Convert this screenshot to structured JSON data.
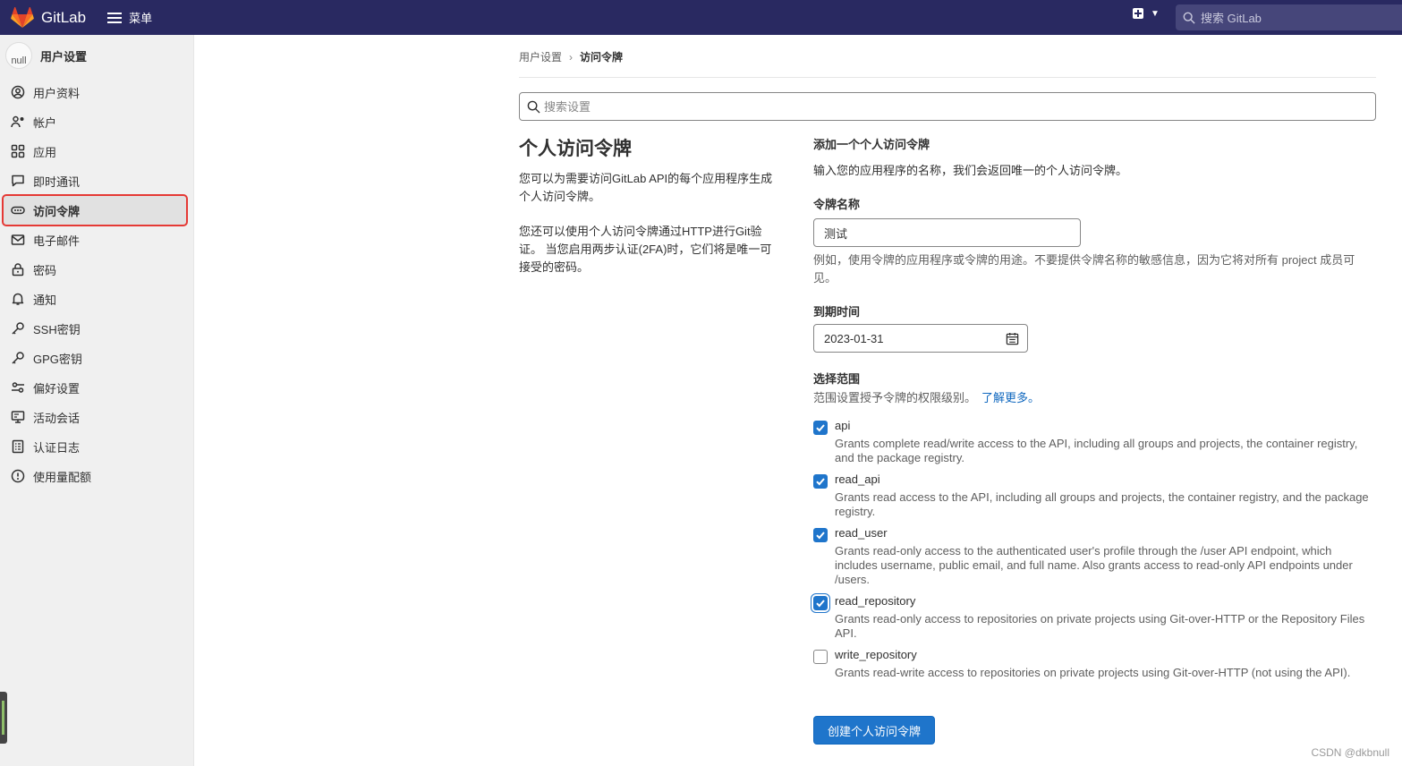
{
  "topbar": {
    "brand": "GitLab",
    "menu_label": "菜单",
    "search_placeholder": "搜索 GitLab",
    "colors": {
      "nav_bg": "#292961",
      "logo_orange": "#e24329"
    }
  },
  "sidebar": {
    "avatar_alt": "null",
    "title": "用户设置",
    "items": [
      {
        "label": "用户资料",
        "icon": "profile-icon",
        "active": false
      },
      {
        "label": "帐户",
        "icon": "account-icon",
        "active": false
      },
      {
        "label": "应用",
        "icon": "applications-icon",
        "active": false
      },
      {
        "label": "即时通讯",
        "icon": "chat-icon",
        "active": false
      },
      {
        "label": "访问令牌",
        "icon": "token-icon",
        "active": true
      },
      {
        "label": "电子邮件",
        "icon": "mail-icon",
        "active": false
      },
      {
        "label": "密码",
        "icon": "lock-icon",
        "active": false
      },
      {
        "label": "通知",
        "icon": "bell-icon",
        "active": false
      },
      {
        "label": "SSH密钥",
        "icon": "key-icon",
        "active": false
      },
      {
        "label": "GPG密钥",
        "icon": "key-icon",
        "active": false
      },
      {
        "label": "偏好设置",
        "icon": "preferences-icon",
        "active": false
      },
      {
        "label": "活动会话",
        "icon": "monitor-icon",
        "active": false
      },
      {
        "label": "认证日志",
        "icon": "log-icon",
        "active": false
      },
      {
        "label": "使用量配额",
        "icon": "quota-icon",
        "active": false
      }
    ]
  },
  "breadcrumb": {
    "parent": "用户设置",
    "current": "访问令牌"
  },
  "settings_search": {
    "placeholder": "搜索设置",
    "value": ""
  },
  "intro": {
    "title": "个人访问令牌",
    "p1": "您可以为需要访问GitLab API的每个应用程序生成个人访问令牌。",
    "p2": "您还可以使用个人访问令牌通过HTTP进行Git验证。 当您启用两步认证(2FA)时，它们将是唯一可接受的密码。"
  },
  "form": {
    "heading": "添加一个个人访问令牌",
    "description": "输入您的应用程序的名称，我们会返回唯一的个人访问令牌。",
    "name_label": "令牌名称",
    "name_value": "测试",
    "name_help": "例如，使用令牌的应用程序或令牌的用途。不要提供令牌名称的敏感信息，因为它将对所有 project 成员可见。",
    "expiry_label": "到期时间",
    "expiry_value": "2023-01-31",
    "scopes_label": "选择范围",
    "scopes_help": "范围设置授予令牌的权限级别。",
    "learn_more": "了解更多。",
    "scopes": [
      {
        "name": "api",
        "checked": true,
        "description": "Grants complete read/write access to the API, including all groups and projects, the container registry, and the package registry."
      },
      {
        "name": "read_api",
        "checked": true,
        "description": "Grants read access to the API, including all groups and projects, the container registry, and the package registry."
      },
      {
        "name": "read_user",
        "checked": true,
        "description": "Grants read-only access to the authenticated user's profile through the /user API endpoint, which includes username, public email, and full name. Also grants access to read-only API endpoints under /users."
      },
      {
        "name": "read_repository",
        "checked": true,
        "description": "Grants read-only access to repositories on private projects using Git-over-HTTP or the Repository Files API."
      },
      {
        "name": "write_repository",
        "checked": false,
        "description": "Grants read-write access to repositories on private projects using Git-over-HTTP (not using the API)."
      }
    ],
    "submit_label": "创建个人访问令牌"
  },
  "watermark": "CSDN @dkbnull"
}
